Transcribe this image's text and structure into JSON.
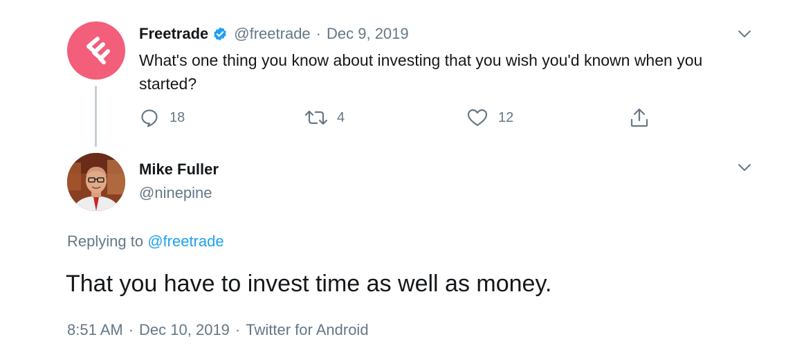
{
  "parent_tweet": {
    "author_name": "Freetrade",
    "author_handle": "@freetrade",
    "separator": "·",
    "date": "Dec 9, 2019",
    "text": "What's one thing you know about investing that you wish you'd known when you started?",
    "reply_count": "18",
    "retweet_count": "4",
    "like_count": "12",
    "verified": true
  },
  "reply_tweet": {
    "author_name": "Mike Fuller",
    "author_handle": "@ninepine",
    "replying_prefix": "Replying to",
    "replying_to": "@freetrade",
    "text": "That you have to invest time as well as money.",
    "time": "8:51 AM",
    "separator": "·",
    "date": "Dec 10, 2019",
    "source": "Twitter for Android"
  },
  "colors": {
    "freetrade_brand": "#f35e7a",
    "verified_blue": "#1da1f2",
    "link_blue": "#1da1f2",
    "secondary_text": "#657786",
    "thread_line": "#c4cfd6"
  },
  "icons": {
    "freetrade_logo": "freetrade-logo-icon",
    "verified": "verified-badge-icon",
    "reply": "reply-icon",
    "retweet": "retweet-icon",
    "like": "like-icon",
    "share": "share-icon",
    "more": "chevron-down-icon"
  }
}
